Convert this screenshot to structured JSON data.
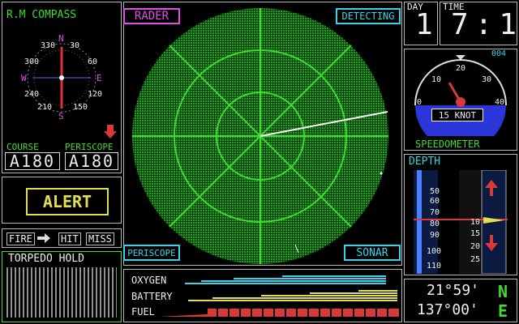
{
  "compass": {
    "title": "R.M COMPASS",
    "ticks": [
      "330",
      "30",
      "60",
      "300",
      "120",
      "240",
      "150",
      "210"
    ],
    "n": "N",
    "e": "E",
    "s": "S",
    "w": "W"
  },
  "course": {
    "label": "COURSE",
    "value": "A180"
  },
  "periscope": {
    "label": "PERISCOPE",
    "value": "A180"
  },
  "alert": {
    "label": "ALERT"
  },
  "fire_controls": {
    "fire": "FIRE",
    "hit": "HIT",
    "miss": "MISS"
  },
  "torpedo": {
    "label": "TORPEDO HOLD"
  },
  "radar": {
    "title": "RADER",
    "status": "DETECTING",
    "periscope_btn": "PERISCOPE",
    "sonar_btn": "SONAR"
  },
  "day": {
    "label": "DAY",
    "value": "1"
  },
  "time": {
    "label": "TIME",
    "value": "7:1"
  },
  "speedometer": {
    "label": "SPEEDOMETER",
    "reading": "15 KNOT",
    "scale": [
      "0",
      "10",
      "20",
      "30",
      "40"
    ],
    "counter": "004"
  },
  "depth": {
    "label": "DEPTH",
    "scale": [
      "50",
      "60",
      "70",
      "80",
      "90",
      "100",
      "110"
    ],
    "right_scale": [
      "10",
      "15",
      "20",
      "25"
    ]
  },
  "resources": {
    "oxygen": "OXYGEN",
    "battery": "BATTERY",
    "fuel": "FUEL",
    "colors": {
      "oxygen": "#39d4e8",
      "battery": "#e2e04a",
      "fuel": "#d83a3a"
    }
  },
  "position": {
    "lat": "21°59'",
    "lon": "137°00'",
    "lat_dir": "N",
    "lon_dir": "E"
  }
}
